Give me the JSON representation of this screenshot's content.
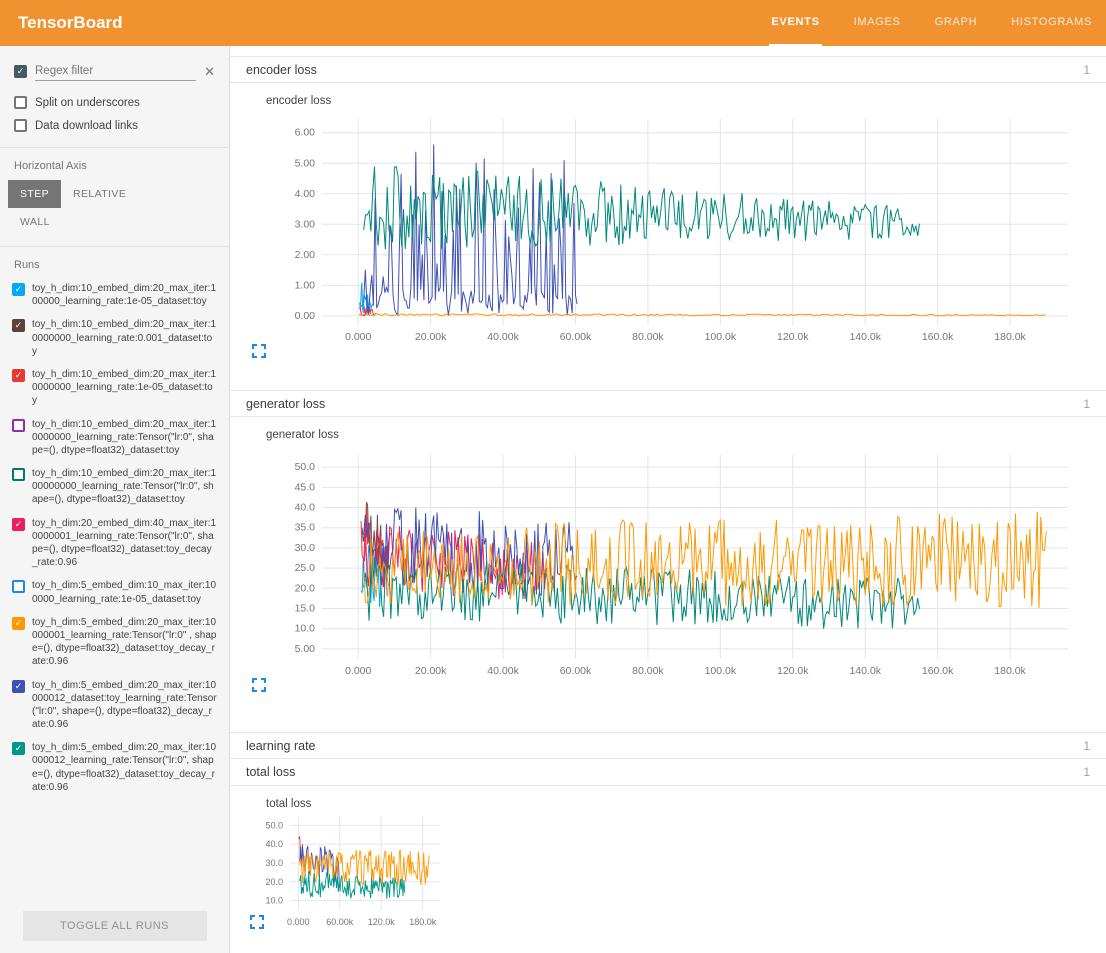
{
  "header": {
    "title": "TensorBoard",
    "tabs": [
      {
        "label": "EVENTS",
        "active": true
      },
      {
        "label": "IMAGES",
        "active": false
      },
      {
        "label": "GRAPH",
        "active": false
      },
      {
        "label": "HISTOGRAMS",
        "active": false
      }
    ]
  },
  "colors": {
    "header_bg": "#f0922f",
    "active_axis_bg": "#757575",
    "expand_icon": "#1e88e5",
    "filter_checkbox": "#455a64"
  },
  "sidebar": {
    "regex_placeholder": "Regex filter",
    "regex_checked": true,
    "options": [
      {
        "label": "Split on underscores",
        "checked": false
      },
      {
        "label": "Data download links",
        "checked": false
      }
    ],
    "horizontal_axis": {
      "label": "Horizontal Axis",
      "modes": [
        {
          "label": "STEP",
          "active": true
        },
        {
          "label": "RELATIVE",
          "active": false
        },
        {
          "label": "WALL",
          "active": false
        }
      ]
    },
    "runs_label": "Runs",
    "toggle_all_label": "TOGGLE ALL RUNS",
    "runs": [
      {
        "label": "toy_h_dim:10_embed_dim:20_max_iter:100000_learning_rate:1e-05_dataset:toy",
        "checked": true,
        "color": "#03a9f4"
      },
      {
        "label": "toy_h_dim:10_embed_dim:20_max_iter:10000000_learning_rate:0.001_dataset:toy",
        "checked": true,
        "color": "#5d4037"
      },
      {
        "label": "toy_h_dim:10_embed_dim:20_max_iter:10000000_learning_rate:1e-05_dataset:toy",
        "checked": true,
        "color": "#e53935"
      },
      {
        "label": "toy_h_dim:10_embed_dim:20_max_iter:10000000_learning_rate:Tensor(\"lr:0\", shape=(), dtype=float32)_dataset:toy",
        "checked": false,
        "color": "#9c27b0"
      },
      {
        "label": "toy_h_dim:10_embed_dim:20_max_iter:100000000_learning_rate:Tensor(\"lr:0\", shape=(), dtype=float32)_dataset:toy",
        "checked": false,
        "color": "#00796b"
      },
      {
        "label": "toy_h_dim:20_embed_dim:40_max_iter:10000001_learning_rate:Tensor(\"lr:0\", shape=(), dtype=float32)_dataset:toy_decay_rate:0.96",
        "checked": true,
        "color": "#e91e63"
      },
      {
        "label": "toy_h_dim:5_embed_dim:10_max_iter:100000_learning_rate:1e-05_dataset:toy",
        "checked": false,
        "color": "#1e88e5"
      },
      {
        "label": "toy_h_dim:5_embed_dim:20_max_iter:10000001_learning_rate:Tensor(\"lr:0\" , shape=(), dtype=float32)_dataset:toy_decay_rate:0.96",
        "checked": true,
        "color": "#ff9800"
      },
      {
        "label": "toy_h_dim:5_embed_dim:20_max_iter:10000012_dataset:toy_learning_rate:Tensor(\"lr:0\", shape=(), dtype=float32)_decay_rate:0.96",
        "checked": true,
        "color": "#3f51b5"
      },
      {
        "label": "toy_h_dim:5_embed_dim:20_max_iter:10000012_learning_rate:Tensor(\"lr:0\", shape=(), dtype=float32)_dataset:toy_decay_rate:0.96",
        "checked": true,
        "color": "#009688"
      }
    ]
  },
  "sections": [
    {
      "title": "encoder loss",
      "count": "1"
    },
    {
      "title": "generator loss",
      "count": "1"
    },
    {
      "title": "learning rate",
      "count": "1"
    },
    {
      "title": "total loss",
      "count": "1"
    }
  ],
  "chart_data": [
    {
      "type": "line",
      "title": "encoder loss",
      "x_domain": [
        -10000,
        196000
      ],
      "y_domain": [
        -0.3,
        6.45
      ],
      "x_ticks": {
        "values": [
          0,
          20000,
          40000,
          60000,
          80000,
          100000,
          120000,
          140000,
          160000,
          180000
        ],
        "labels": [
          "0.000",
          "20.00k",
          "40.00k",
          "60.00k",
          "80.00k",
          "100.0k",
          "120.0k",
          "140.0k",
          "160.0k",
          "180.0k"
        ]
      },
      "y_ticks": {
        "values": [
          0,
          1,
          2,
          3,
          4,
          5,
          6
        ],
        "labels": [
          "0.00",
          "1.00",
          "2.00",
          "3.00",
          "4.00",
          "5.00",
          "6.00"
        ]
      },
      "grid": true,
      "series": [
        {
          "name": "run-red",
          "color": "#e53935",
          "x0": 400,
          "x1": 5000,
          "step": 250,
          "base": [
            0.3,
            0.1
          ],
          "amp": [
            0.3,
            0.1
          ],
          "clamp": [
            0,
            1.0
          ],
          "seed": 11
        },
        {
          "name": "run-lightblue",
          "color": "#03a9f4",
          "x0": 400,
          "x1": 4000,
          "step": 200,
          "base": [
            0.7,
            0.2
          ],
          "amp": [
            0.6,
            0.2
          ],
          "clamp": [
            0,
            1.4
          ],
          "seed": 12
        },
        {
          "name": "run-pink",
          "color": "#e91e63",
          "x0": 400,
          "x1": 3500,
          "step": 250,
          "base": [
            0.25,
            0.1
          ],
          "amp": [
            0.25,
            0.1
          ],
          "clamp": [
            0,
            0.8
          ],
          "seed": 13
        },
        {
          "name": "run-indigo",
          "color": "#3f51b5",
          "x0": 1500,
          "x1": 60500,
          "step": 450,
          "base": [
            0.5,
            0.4
          ],
          "amp": [
            0.5,
            0.4
          ],
          "spike_prob": 0.38,
          "spike_amp": 5.2,
          "clamp": [
            0.02,
            5.95
          ],
          "seed": 14
        },
        {
          "name": "run-teal",
          "color": "#00897b",
          "x0": 1500,
          "x1": 155000,
          "step": 500,
          "base": [
            3.6,
            3.05
          ],
          "amp": [
            1.5,
            0.5
          ],
          "clamp": [
            0.1,
            5.6
          ],
          "seed": 15
        },
        {
          "name": "run-orange",
          "color": "#ff9800",
          "x0": 200,
          "x1": 190000,
          "step": 800,
          "base": [
            0.04,
            0.02
          ],
          "amp": [
            0.04,
            0.02
          ],
          "clamp": [
            0,
            0.3
          ],
          "seed": 16
        }
      ]
    },
    {
      "type": "line",
      "title": "generator loss",
      "x_domain": [
        -10000,
        196000
      ],
      "y_domain": [
        2.5,
        53
      ],
      "x_ticks": {
        "values": [
          0,
          20000,
          40000,
          60000,
          80000,
          100000,
          120000,
          140000,
          160000,
          180000
        ],
        "labels": [
          "0.000",
          "20.00k",
          "40.00k",
          "60.00k",
          "80.00k",
          "100.0k",
          "120.0k",
          "140.0k",
          "160.0k",
          "180.0k"
        ]
      },
      "y_ticks": {
        "values": [
          5,
          10,
          15,
          20,
          25,
          30,
          35,
          40,
          45,
          50
        ],
        "labels": [
          "5.00",
          "10.0",
          "15.0",
          "20.0",
          "25.0",
          "30.0",
          "35.0",
          "40.0",
          "45.0",
          "50.0"
        ]
      },
      "grid": true,
      "series": [
        {
          "name": "run-brown",
          "color": "#6d4c41",
          "x0": 800,
          "x1": 9000,
          "step": 300,
          "base": [
            36,
            28
          ],
          "amp": [
            9,
            7
          ],
          "clamp": [
            8,
            48
          ],
          "seed": 21
        },
        {
          "name": "run-red",
          "color": "#e53935",
          "x0": 800,
          "x1": 8000,
          "step": 300,
          "base": [
            34,
            26
          ],
          "amp": [
            11,
            8
          ],
          "clamp": [
            8,
            49
          ],
          "seed": 22
        },
        {
          "name": "run-lightblue",
          "color": "#03a9f4",
          "x0": 800,
          "x1": 7000,
          "step": 300,
          "base": [
            26,
            20
          ],
          "amp": [
            8,
            6
          ],
          "clamp": [
            8,
            42
          ],
          "seed": 23
        },
        {
          "name": "run-pink",
          "color": "#e91e63",
          "x0": 1500,
          "x1": 52000,
          "step": 450,
          "base": [
            28,
            24
          ],
          "amp": [
            9,
            8
          ],
          "clamp": [
            8,
            48
          ],
          "seed": 24
        },
        {
          "name": "run-indigo",
          "color": "#3f51b5",
          "x0": 1500,
          "x1": 60500,
          "step": 450,
          "base": [
            31,
            27
          ],
          "amp": [
            11,
            10
          ],
          "clamp": [
            10,
            51
          ],
          "seed": 25
        },
        {
          "name": "run-teal",
          "color": "#00897b",
          "x0": 1500,
          "x1": 155000,
          "step": 500,
          "base": [
            20,
            16
          ],
          "amp": [
            8,
            6.5
          ],
          "clamp": [
            6,
            44
          ],
          "seed": 26
        },
        {
          "name": "run-orange",
          "color": "#ff9800",
          "x0": 1500,
          "x1": 190000,
          "step": 500,
          "base": [
            26,
            27
          ],
          "amp": [
            10,
            12
          ],
          "clamp": [
            8,
            47
          ],
          "seed": 27
        }
      ]
    },
    {
      "type": "line",
      "title": "total loss",
      "x_domain": [
        -12000,
        205000
      ],
      "y_domain": [
        5,
        55
      ],
      "x_ticks": {
        "values": [
          0,
          60000,
          120000,
          180000
        ],
        "labels": [
          "0.000",
          "60.00k",
          "120.0k",
          "180.0k"
        ]
      },
      "y_ticks": {
        "values": [
          10,
          20,
          30,
          40,
          50
        ],
        "labels": [
          "10.0",
          "20.0",
          "30.0",
          "40.0",
          "50.0"
        ]
      },
      "grid": true,
      "series": [
        {
          "name": "run-red",
          "color": "#e53935",
          "x0": 1000,
          "x1": 8000,
          "step": 700,
          "base": [
            40,
            30
          ],
          "amp": [
            8,
            6
          ],
          "clamp": [
            10,
            50
          ],
          "seed": 31
        },
        {
          "name": "run-indigo",
          "color": "#3f51b5",
          "x0": 2000,
          "x1": 60000,
          "step": 1300,
          "base": [
            33,
            28
          ],
          "amp": [
            10,
            9
          ],
          "clamp": [
            12,
            50
          ],
          "seed": 32
        },
        {
          "name": "run-orange",
          "color": "#ff9800",
          "x0": 2000,
          "x1": 190000,
          "step": 1300,
          "base": [
            28,
            27
          ],
          "amp": [
            9,
            10
          ],
          "clamp": [
            10,
            48
          ],
          "seed": 33
        },
        {
          "name": "run-teal",
          "color": "#009688",
          "x0": 2000,
          "x1": 155000,
          "step": 1300,
          "base": [
            19,
            16
          ],
          "amp": [
            7,
            6
          ],
          "clamp": [
            8,
            40
          ],
          "seed": 34
        }
      ]
    }
  ]
}
